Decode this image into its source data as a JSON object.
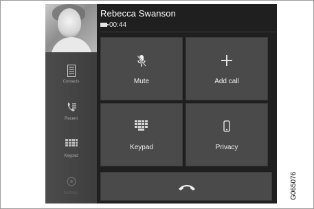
{
  "call": {
    "caller_name": "Rebecca Swanson",
    "duration": "00:44"
  },
  "sidebar": {
    "items": [
      {
        "label": "Contacts",
        "icon": "contacts-list-icon"
      },
      {
        "label": "Recent",
        "icon": "recent-calls-icon"
      },
      {
        "label": "Keypad",
        "icon": "keypad-icon"
      },
      {
        "label": "Settings",
        "icon": "settings-icon",
        "dimmed": true
      }
    ]
  },
  "actions": [
    {
      "label": "Mute",
      "icon": "microphone-muted-icon"
    },
    {
      "label": "Add call",
      "icon": "plus-icon"
    },
    {
      "label": "Keypad",
      "icon": "keypad-icon"
    },
    {
      "label": "Privacy",
      "icon": "phone-device-icon"
    }
  ],
  "end_call": {
    "icon": "end-call-icon"
  },
  "figure_code": "G065076"
}
